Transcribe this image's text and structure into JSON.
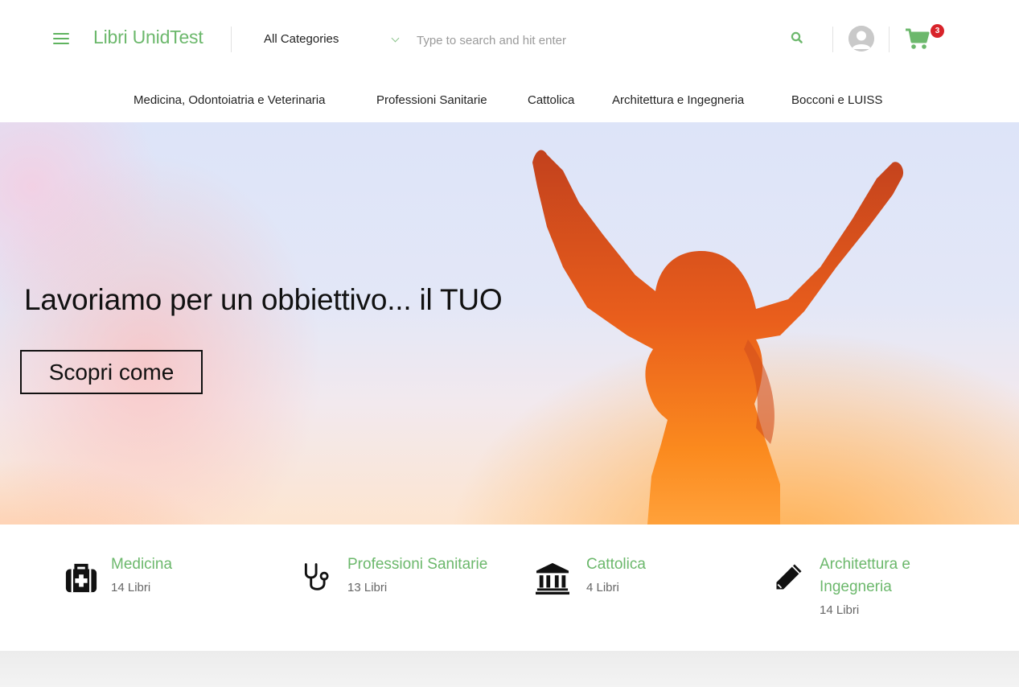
{
  "header": {
    "logo": "Libri UnidTest",
    "category_select": {
      "selected": "All Categories"
    },
    "search": {
      "placeholder": "Type to search and hit enter"
    },
    "cart": {
      "count": "3"
    },
    "accent_color": "#6cb86c",
    "badge_color": "#d8232a"
  },
  "nav": {
    "items": [
      {
        "label": "Medicina, Odontoiatria e Veterinaria"
      },
      {
        "label": "Professioni Sanitarie"
      },
      {
        "label": "Cattolica"
      },
      {
        "label": "Architettura e Ingegneria"
      },
      {
        "label": "Bocconi e LUISS"
      }
    ]
  },
  "hero": {
    "title": "Lavoriamo per un obbiettivo... il TUO",
    "cta": "Scopri come"
  },
  "categories": [
    {
      "name": "Medicina",
      "count": "14 Libri",
      "icon": "medical-kit-icon"
    },
    {
      "name": "Professioni Sanitarie",
      "count": "13 Libri",
      "icon": "stethoscope-icon"
    },
    {
      "name": "Cattolica",
      "count": "4 Libri",
      "icon": "institution-icon"
    },
    {
      "name_line1": "Architettura e",
      "name_line2": "Ingegneria",
      "count": "14 Libri",
      "icon": "pencil-icon"
    }
  ]
}
